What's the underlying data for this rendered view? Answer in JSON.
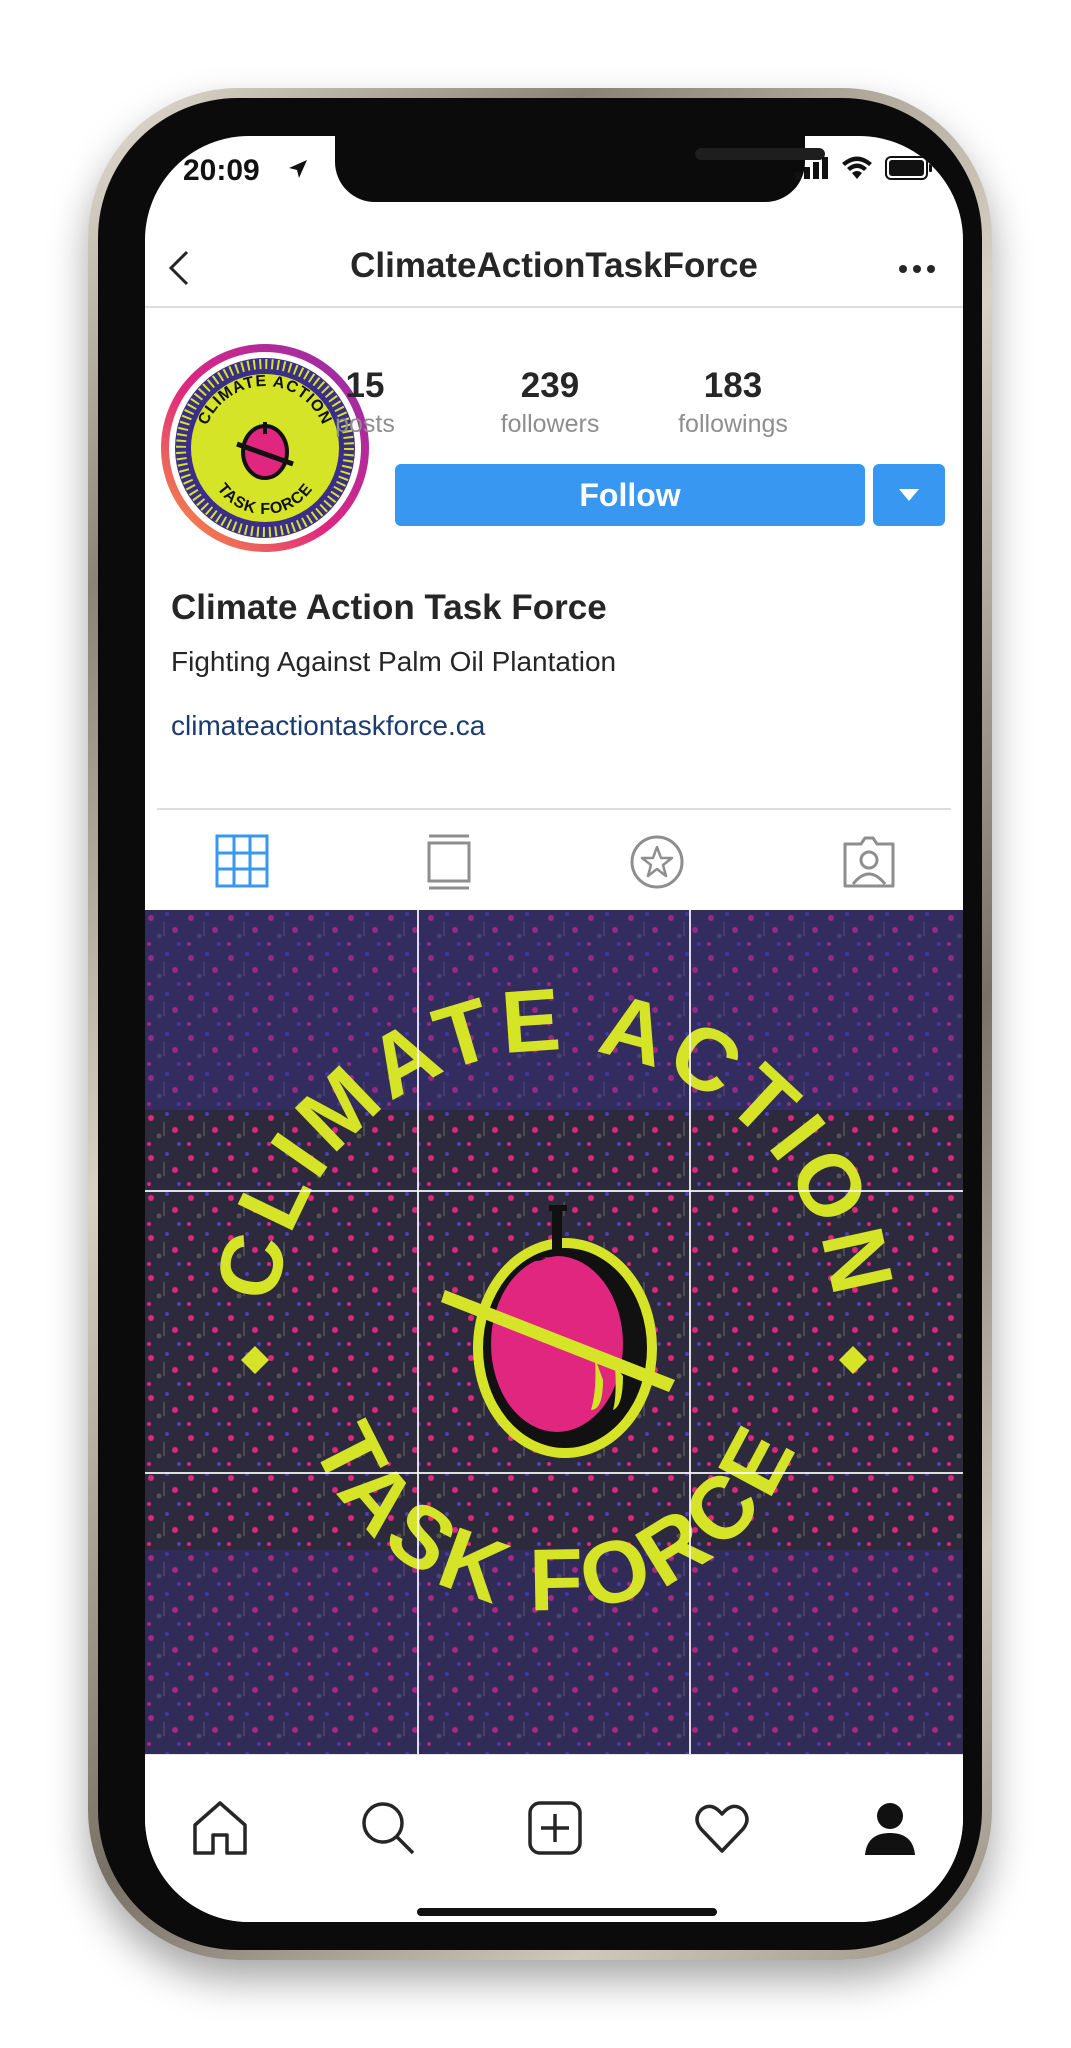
{
  "status_bar": {
    "time": "20:09"
  },
  "header": {
    "username": "ClimateActionTaskForce"
  },
  "profile": {
    "stats": [
      {
        "value": "15",
        "label": "posts"
      },
      {
        "value": "239",
        "label": "followers"
      },
      {
        "value": "183",
        "label": "followings"
      }
    ],
    "follow_label": "Follow",
    "display_name": "Climate Action Task Force",
    "bio": "Fighting Against Palm Oil Plantation",
    "website": "climateactiontaskforce.ca"
  },
  "logo": {
    "text_top": "CLIMATE ACTION",
    "text_bottom": "TASK FORCE"
  },
  "tabs": [
    "grid-icon",
    "feed-icon",
    "star-icon",
    "tagged-icon"
  ],
  "bottom_nav": [
    "home-icon",
    "search-icon",
    "add-icon",
    "heart-icon",
    "profile-icon"
  ],
  "colors": {
    "accent": "#3897f0",
    "logo_yellow": "#d6e428",
    "logo_pink": "#e0267f",
    "logo_purple": "#3b2e8a",
    "link": "#1c3b6e"
  }
}
